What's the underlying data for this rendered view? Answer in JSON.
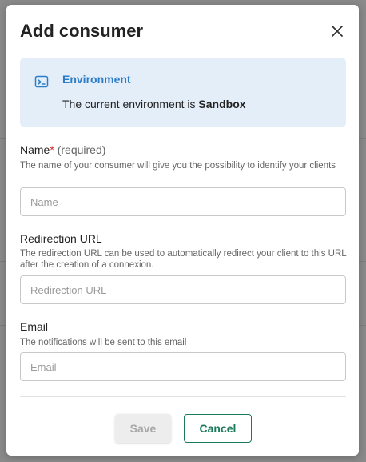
{
  "modal": {
    "title": "Add consumer",
    "close_icon": "close-icon"
  },
  "environment": {
    "icon": "terminal-icon",
    "title": "Environment",
    "text_prefix": "The current environment is",
    "value": "Sandbox"
  },
  "fields": {
    "name": {
      "label": "Name",
      "required_star": "*",
      "required_note": "(required)",
      "help": "The name of your consumer will give you the possibility to identify your clients",
      "value": "",
      "placeholder": "Name"
    },
    "redirection_url": {
      "label": "Redirection URL",
      "help": "The redirection URL can be used to automatically redirect your client to this URL after the creation of a connexion.",
      "value": "",
      "placeholder": "Redirection URL"
    },
    "email": {
      "label": "Email",
      "help": "The notifications will be sent to this email",
      "value": "",
      "placeholder": "Email"
    }
  },
  "actions": {
    "save_label": "Save",
    "cancel_label": "Cancel"
  },
  "colors": {
    "accent": "#1a7a5a",
    "info_title": "#2d7cc7",
    "info_background": "#e4eef9",
    "required": "#dd2222"
  }
}
